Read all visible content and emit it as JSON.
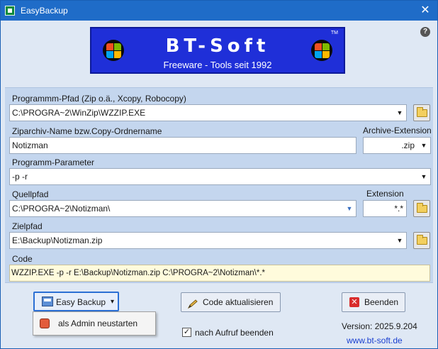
{
  "window": {
    "title": "EasyBackup",
    "close_glyph": "✕",
    "help_glyph": "?"
  },
  "banner": {
    "brand": "BT-Soft",
    "tagline": "Freeware - Tools seit 1992",
    "tm": "TM"
  },
  "fields": {
    "program_path": {
      "label": "Programmm-Pfad (Zip o.ä., Xcopy, Robocopy)",
      "value": "C:\\PROGRA~2\\WinZip\\WZZIP.EXE"
    },
    "archive_name": {
      "label": "Ziparchiv-Name bzw.Copy-Ordnername",
      "value": "Notizman"
    },
    "archive_ext": {
      "label": "Archive-Extension",
      "value": ".zip"
    },
    "program_params": {
      "label": "Programm-Parameter",
      "value": "-p -r"
    },
    "source_path": {
      "label": "Quellpfad",
      "value": "C:\\PROGRA~2\\Notizman\\"
    },
    "source_ext": {
      "label": "Extension",
      "value": "*.*"
    },
    "target_path": {
      "label": "Zielpfad",
      "value": "E:\\Backup\\Notizman.zip"
    },
    "code": {
      "label": "Code",
      "value": "WZZIP.EXE -p -r E:\\Backup\\Notizman.zip C:\\PROGRA~2\\Notizman\\*.*"
    }
  },
  "buttons": {
    "easy_backup": "Easy Backup",
    "update_code": "Code aktualisieren",
    "quit": "Beenden",
    "dropdown_glyph": "▾"
  },
  "menu": {
    "restart_admin": "als Admin neustarten"
  },
  "footer": {
    "close_after_run_label": "nach Aufruf beenden",
    "close_after_run_checked": true,
    "check_glyph": "✓",
    "version": "Version: 2025.9.204",
    "website": "www.bt-soft.de"
  },
  "icons": {
    "combo_arrow": "▼"
  },
  "colors": {
    "titlebar": "#1f6cc8",
    "banner": "#1f2fd8",
    "panel": "#c4d6ee",
    "code_bg": "#fffbdc",
    "link": "#1a3fd0"
  }
}
